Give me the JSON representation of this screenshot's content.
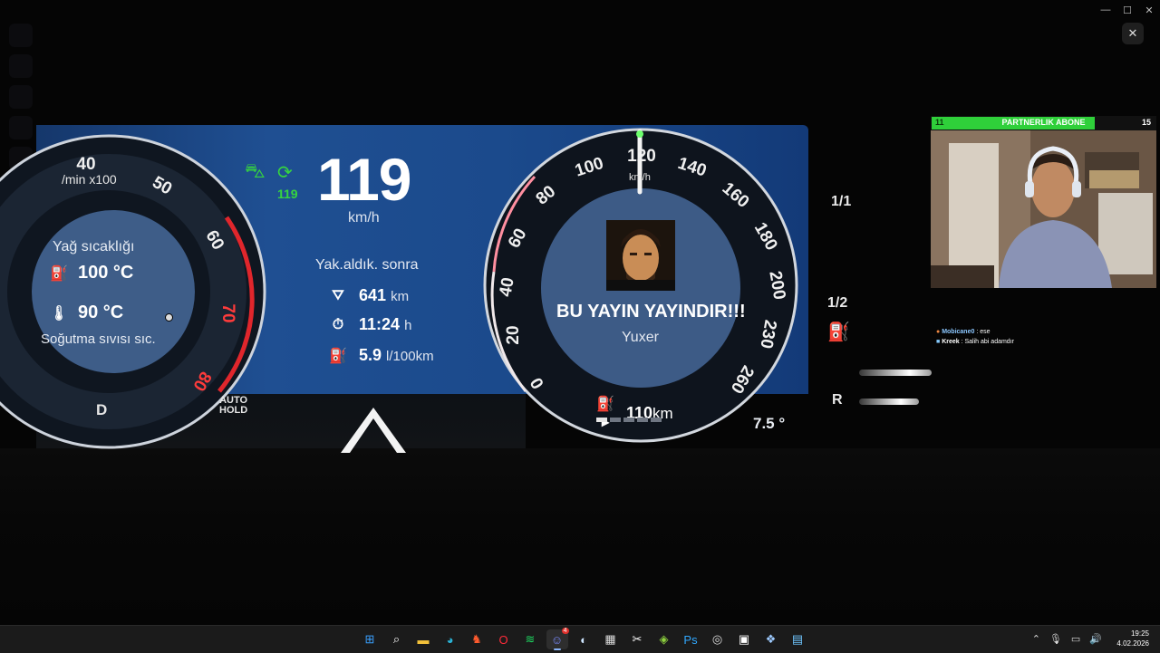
{
  "window": {
    "controls": {
      "minimize": "—",
      "maximize": "☐",
      "close": "✕"
    },
    "overlay_close": "✕"
  },
  "cluster": {
    "tacho": {
      "ticks": [
        "40",
        "50",
        "60",
        "70",
        "80"
      ],
      "unit_label": "/min x100",
      "oil_title": "Yağ sıcaklığı",
      "oil_temp": "100 °C",
      "coolant_temp": "90 °C",
      "coolant_label": "Soğutma sıvısı sıc.",
      "gear": "D"
    },
    "auto_hold": "AUTO\nHOLD",
    "speed_value": "119",
    "speed_unit": "km/h",
    "speed_limit": "119",
    "range_title": "Yak.aldık. sonra",
    "trip_distance_value": "641",
    "trip_distance_unit": "km",
    "trip_time_value": "11:24",
    "trip_time_unit": "h",
    "consumption_value": "5.9",
    "consumption_unit": "l/100km",
    "speedo": {
      "ticks": [
        "0",
        "20",
        "40",
        "60",
        "80",
        "100",
        "120",
        "140",
        "160",
        "180",
        "200",
        "230",
        "260"
      ],
      "unit": "km/h",
      "banner": "BU YAYIN YAYINDIR!!!",
      "sub_banner": "Yuxer",
      "fuel_range_value": "110",
      "fuel_range_unit": "km"
    },
    "outside_temp": "7.5 °",
    "page_top": "1/1",
    "page_bottom": "1/2",
    "gear_r": "R"
  },
  "webcam": {
    "bar_left": "11",
    "bar_title": "PARTNERLIK ABONE",
    "bar_right": "15",
    "progress": 0.73
  },
  "chat": [
    {
      "user": "Mobicane0",
      "message": ": ese"
    },
    {
      "user": "Kreek",
      "message": ": Salih abi adamdır"
    }
  ],
  "taskbar": {
    "apps": [
      {
        "name": "windows-start",
        "glyph": "⊞",
        "color": "#3aa0ff"
      },
      {
        "name": "search",
        "glyph": "⌕",
        "color": "#ffffff"
      },
      {
        "name": "file-explorer",
        "glyph": "▬",
        "color": "#f3c13a"
      },
      {
        "name": "edge",
        "glyph": "◕",
        "color": "#2bb3d6"
      },
      {
        "name": "brave",
        "glyph": "♞",
        "color": "#ff5b2e"
      },
      {
        "name": "opera",
        "glyph": "O",
        "color": "#ff2b3a"
      },
      {
        "name": "spotify",
        "glyph": "≋",
        "color": "#1ed760"
      },
      {
        "name": "discord",
        "glyph": "☺",
        "color": "#7a8bff"
      },
      {
        "name": "steam",
        "glyph": "◐",
        "color": "#cfe6ff"
      },
      {
        "name": "calculator",
        "glyph": "▦",
        "color": "#dddddd"
      },
      {
        "name": "capcut",
        "glyph": "✂",
        "color": "#ffffff"
      },
      {
        "name": "xbox-app",
        "glyph": "◈",
        "color": "#8fd33f"
      },
      {
        "name": "photoshop",
        "glyph": "Ps",
        "color": "#31a8ff"
      },
      {
        "name": "obs",
        "glyph": "◎",
        "color": "#dddddd"
      },
      {
        "name": "elgato",
        "glyph": "▣",
        "color": "#ffffff"
      },
      {
        "name": "vpn",
        "glyph": "❖",
        "color": "#9ecbff"
      },
      {
        "name": "notepad",
        "glyph": "▤",
        "color": "#6fc6ff"
      }
    ],
    "active_app": "discord",
    "discord_badge": "4",
    "tray": {
      "chevron": "⌃",
      "mic": "🎙",
      "display": "▭",
      "volume": "🔊"
    },
    "time": "19:25",
    "date": "4.02.2026"
  }
}
